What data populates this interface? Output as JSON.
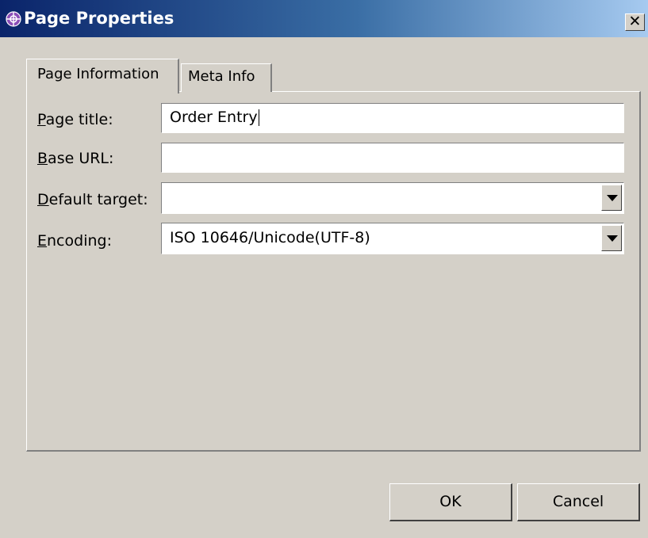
{
  "window": {
    "title": "Page Properties",
    "close_glyph": "✕",
    "app_icon": "page-properties-icon"
  },
  "tabs": [
    {
      "label": "Page Information",
      "active": true
    },
    {
      "label": "Meta Info",
      "active": false
    }
  ],
  "form": {
    "page_title": {
      "label_mnemonic": "P",
      "label_rest": "age title:",
      "value": "Order Entry"
    },
    "base_url": {
      "label_mnemonic": "B",
      "label_rest": "ase URL:",
      "value": ""
    },
    "default_target": {
      "label_mnemonic": "D",
      "label_rest": "efault target:",
      "value": ""
    },
    "encoding": {
      "label_mnemonic": "E",
      "label_rest": "ncoding:",
      "value": "ISO 10646/Unicode(UTF-8)"
    }
  },
  "buttons": {
    "ok": "OK",
    "cancel": "Cancel"
  },
  "colors": {
    "titlebar_start": "#0a246a",
    "titlebar_end": "#a6caf0",
    "dialog_bg": "#d4d0c8",
    "app_icon": "#8c4fb8"
  }
}
